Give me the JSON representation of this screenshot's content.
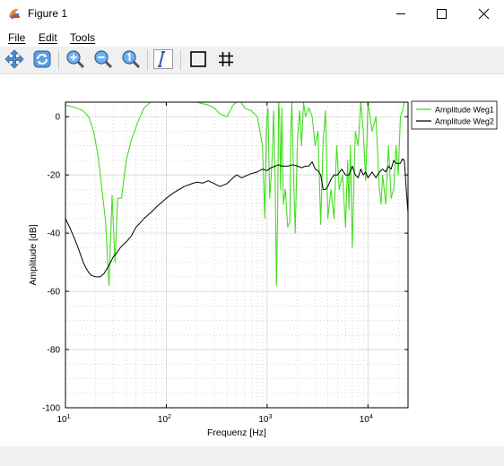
{
  "window": {
    "title": "Figure 1"
  },
  "menu": {
    "items": [
      "File",
      "Edit",
      "Tools"
    ]
  },
  "toolbar": {
    "buttons": [
      "pan-icon",
      "rotate-icon",
      "zoom-in-icon",
      "zoom-out-icon",
      "zoom-reset-icon",
      "insert-text-icon",
      "toggle-box-icon",
      "toggle-grid-icon"
    ]
  },
  "colors": {
    "series1": "#44dd22",
    "series2": "#000000",
    "grid": "#bdbdbd"
  },
  "chart_data": {
    "type": "line",
    "xlabel": "Frequenz [Hz]",
    "ylabel": "Amplitude [dB]",
    "xscale": "log",
    "xlim": [
      10,
      25000
    ],
    "ylim": [
      -100,
      5
    ],
    "xticks": [
      {
        "base": "10",
        "exp": "1"
      },
      {
        "base": "10",
        "exp": "2"
      },
      {
        "base": "10",
        "exp": "3"
      },
      {
        "base": "10",
        "exp": "4"
      }
    ],
    "yticks": [
      "0",
      "-20",
      "-40",
      "-60",
      "-80",
      "-100"
    ],
    "grid": "on (major and minor)",
    "legend_position": "top-right outside",
    "series": [
      {
        "name": "Amplitude Weg1",
        "color": "#44dd22",
        "x": [
          10,
          13,
          15,
          17,
          19,
          21,
          23,
          25,
          27,
          29,
          31,
          33,
          36,
          40,
          45,
          52,
          60,
          70,
          82,
          100,
          120,
          160,
          200,
          260,
          300,
          340,
          400,
          460,
          500,
          550,
          600,
          700,
          800,
          900,
          950,
          980,
          1000,
          1020,
          1060,
          1100,
          1130,
          1160,
          1200,
          1240,
          1270,
          1300,
          1330,
          1360,
          1400,
          1450,
          1520,
          1600,
          1680,
          1720,
          1760,
          1800,
          1900,
          2000,
          2100,
          2200,
          2300,
          2400,
          2600,
          2800,
          3000,
          3200,
          3400,
          3600,
          3800,
          4000,
          4300,
          4600,
          4900,
          5200,
          5600,
          6000,
          6300,
          6500,
          6700,
          7000,
          7500,
          8000,
          8500,
          9000,
          9500,
          10000,
          11000,
          12000,
          13000,
          13500,
          14000,
          15000,
          16000,
          17000,
          18000,
          19000,
          20000,
          21000,
          22000,
          23000
        ],
        "y": [
          4,
          3,
          2,
          0,
          -5,
          -13,
          -25,
          -36,
          -58,
          -27,
          -50,
          -28,
          -28,
          -15,
          -8,
          -2,
          3,
          5,
          5,
          5,
          5,
          5,
          5,
          4,
          3,
          1,
          0,
          4,
          5,
          5,
          3,
          2,
          0,
          -10,
          -35,
          -5,
          0,
          3,
          -28,
          -20,
          -12,
          2,
          -20,
          -58,
          -35,
          5,
          0,
          -25,
          3,
          -30,
          -25,
          -38,
          -36,
          -5,
          5,
          -10,
          -40,
          -8,
          2,
          -10,
          5,
          0,
          3,
          0,
          -10,
          -5,
          -37,
          -8,
          2,
          -35,
          -25,
          -35,
          -10,
          -25,
          -20,
          -38,
          -15,
          -32,
          -10,
          -45,
          -5,
          -10,
          5,
          -5,
          -22,
          5,
          -5,
          0,
          -25,
          -30,
          -20,
          -30,
          -10,
          -28,
          -25,
          -10,
          -20,
          0,
          2,
          5
        ]
      },
      {
        "name": "Amplitude Weg2",
        "color": "#000000",
        "x": [
          10,
          11,
          12,
          13,
          14,
          15,
          16,
          17,
          18,
          20,
          22,
          24,
          26,
          28,
          30,
          32,
          35,
          40,
          45,
          50,
          55,
          60,
          70,
          80,
          100,
          120,
          150,
          180,
          200,
          230,
          260,
          300,
          340,
          400,
          460,
          500,
          560,
          600,
          700,
          800,
          900,
          1000,
          1100,
          1200,
          1300,
          1400,
          1600,
          1800,
          2000,
          2200,
          2400,
          2600,
          2800,
          3000,
          3200,
          3400,
          3600,
          3800,
          4000,
          4300,
          4600,
          5000,
          5500,
          6000,
          6500,
          7000,
          7500,
          8000,
          8500,
          9000,
          9500,
          10000,
          11000,
          12000,
          13000,
          14000,
          15000,
          16000,
          17000,
          18000,
          19000,
          20000,
          21000,
          22000,
          23000,
          24000,
          25000
        ],
        "y": [
          -35,
          -38,
          -41,
          -44,
          -47,
          -50,
          -52,
          -53.5,
          -54.5,
          -55,
          -55,
          -54,
          -52,
          -50,
          -48,
          -47,
          -45,
          -43,
          -41,
          -38,
          -36.5,
          -35,
          -33,
          -31,
          -28,
          -26,
          -24,
          -23,
          -22.5,
          -22.8,
          -22,
          -23,
          -24,
          -23,
          -21,
          -20,
          -21,
          -20.5,
          -19.5,
          -19,
          -18,
          -18.5,
          -17.5,
          -17,
          -16.5,
          -17,
          -17,
          -16.5,
          -17,
          -17.5,
          -17,
          -17,
          -15.5,
          -18,
          -18.5,
          -20,
          -25,
          -25,
          -24,
          -21.5,
          -20,
          -20,
          -18,
          -20,
          -20,
          -17,
          -20,
          -21,
          -18,
          -20,
          -19,
          -21,
          -19,
          -21,
          -19,
          -18,
          -19,
          -17,
          -18,
          -15,
          -16,
          -16,
          -16,
          -14.5,
          -15,
          -25,
          -33
        ]
      }
    ]
  }
}
